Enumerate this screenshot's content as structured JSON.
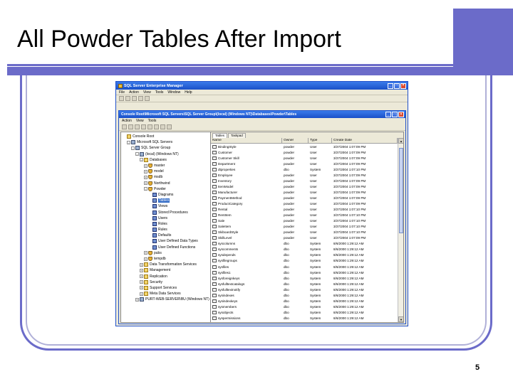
{
  "slide": {
    "title": "All Powder Tables After Import",
    "page_number": "5",
    "accent_color": "#6b6bc9"
  },
  "window": {
    "title": "SQL Server Enterprise Manager",
    "menu": [
      "File",
      "Action",
      "View",
      "Tools",
      "Window",
      "Help"
    ]
  },
  "inner_window": {
    "title": "Console Root\\Microsoft SQL Servers\\SQL Server Group\\(local) (Windows NT)\\Databases\\Powder\\Tables",
    "menu": [
      "Action",
      "View",
      "Tools"
    ]
  },
  "tree": [
    {
      "label": "Console Root",
      "level": 0,
      "icon": "folder",
      "exp": ""
    },
    {
      "label": "Microsoft SQL Servers",
      "level": 1,
      "icon": "srv",
      "exp": "-"
    },
    {
      "label": "SQL Server Group",
      "level": 2,
      "icon": "srv",
      "exp": "-"
    },
    {
      "label": "(local) (Windows NT)",
      "level": 3,
      "icon": "srv",
      "exp": "-"
    },
    {
      "label": "Databases",
      "level": 4,
      "icon": "folder",
      "exp": "-"
    },
    {
      "label": "master",
      "level": 5,
      "icon": "db",
      "exp": "+"
    },
    {
      "label": "model",
      "level": 5,
      "icon": "db",
      "exp": "+"
    },
    {
      "label": "msdb",
      "level": 5,
      "icon": "db",
      "exp": "+"
    },
    {
      "label": "Northwind",
      "level": 5,
      "icon": "db",
      "exp": "+"
    },
    {
      "label": "Powder",
      "level": 5,
      "icon": "db",
      "exp": "-"
    },
    {
      "label": "Diagrams",
      "level": 6,
      "icon": "obj",
      "exp": ""
    },
    {
      "label": "Tables",
      "level": 6,
      "icon": "obj",
      "exp": "",
      "selected": true
    },
    {
      "label": "Views",
      "level": 6,
      "icon": "obj",
      "exp": ""
    },
    {
      "label": "Stored Procedures",
      "level": 6,
      "icon": "obj",
      "exp": ""
    },
    {
      "label": "Users",
      "level": 6,
      "icon": "obj",
      "exp": ""
    },
    {
      "label": "Roles",
      "level": 6,
      "icon": "obj",
      "exp": ""
    },
    {
      "label": "Rules",
      "level": 6,
      "icon": "obj",
      "exp": ""
    },
    {
      "label": "Defaults",
      "level": 6,
      "icon": "obj",
      "exp": ""
    },
    {
      "label": "User Defined Data Types",
      "level": 6,
      "icon": "obj",
      "exp": ""
    },
    {
      "label": "User Defined Functions",
      "level": 6,
      "icon": "obj",
      "exp": ""
    },
    {
      "label": "pubs",
      "level": 5,
      "icon": "db",
      "exp": "+"
    },
    {
      "label": "tempdb",
      "level": 5,
      "icon": "db",
      "exp": "+"
    },
    {
      "label": "Data Transformation Services",
      "level": 4,
      "icon": "folder",
      "exp": "+"
    },
    {
      "label": "Management",
      "level": 4,
      "icon": "folder",
      "exp": "+"
    },
    {
      "label": "Replication",
      "level": 4,
      "icon": "folder",
      "exp": "+"
    },
    {
      "label": "Security",
      "level": 4,
      "icon": "folder",
      "exp": "+"
    },
    {
      "label": "Support Services",
      "level": 4,
      "icon": "folder",
      "exp": "+"
    },
    {
      "label": "Meta Data Services",
      "level": 4,
      "icon": "folder",
      "exp": "+"
    },
    {
      "label": "PURT-WEB-SERVER\\BU (Windows NT)",
      "level": 3,
      "icon": "srv",
      "exp": "+"
    }
  ],
  "tabs": [
    "Tables",
    "Taskpad"
  ],
  "columns": [
    "Name",
    "Owner",
    "Type",
    "Create Date"
  ],
  "rows": [
    [
      "BindingStyle",
      "powder",
      "User",
      "3/27/2004 1:07:09 PM"
    ],
    [
      "Customer",
      "powder",
      "User",
      "3/27/2004 1:07:09 PM"
    ],
    [
      "Customer Skill",
      "powder",
      "User",
      "3/27/2004 1:07:09 PM"
    ],
    [
      "Department",
      "powder",
      "User",
      "3/27/2004 1:07:09 PM"
    ],
    [
      "dtproperties",
      "dbo",
      "System",
      "3/27/2004 1:07:10 PM"
    ],
    [
      "Employee",
      "powder",
      "User",
      "3/27/2004 1:07:09 PM"
    ],
    [
      "Inventory",
      "powder",
      "User",
      "3/27/2004 1:07:09 PM"
    ],
    [
      "ItemModel",
      "powder",
      "User",
      "3/27/2004 1:07:09 PM"
    ],
    [
      "Manufacturer",
      "powder",
      "User",
      "3/27/2004 1:07:09 PM"
    ],
    [
      "PaymentMethod",
      "powder",
      "User",
      "3/27/2004 1:07:09 PM"
    ],
    [
      "ProductCategory",
      "powder",
      "User",
      "3/27/2004 1:07:09 PM"
    ],
    [
      "Rental",
      "powder",
      "User",
      "3/27/2004 1:07:10 PM"
    ],
    [
      "RentItem",
      "powder",
      "User",
      "3/27/2004 1:07:10 PM"
    ],
    [
      "Sale",
      "powder",
      "User",
      "3/27/2004 1:07:10 PM"
    ],
    [
      "SaleItem",
      "powder",
      "User",
      "3/27/2004 1:07:10 PM"
    ],
    [
      "SkiboardStyle",
      "powder",
      "User",
      "3/27/2004 1:07:10 PM"
    ],
    [
      "SkillLevel",
      "powder",
      "User",
      "3/27/2004 1:07:09 PM"
    ],
    [
      "syscolumns",
      "dbo",
      "System",
      "8/6/2000 1:29:12 AM"
    ],
    [
      "syscomments",
      "dbo",
      "System",
      "8/6/2000 1:29:12 AM"
    ],
    [
      "sysdepends",
      "dbo",
      "System",
      "8/6/2000 1:29:12 AM"
    ],
    [
      "sysfilegroups",
      "dbo",
      "System",
      "8/6/2000 1:29:12 AM"
    ],
    [
      "sysfiles",
      "dbo",
      "System",
      "8/6/2000 1:29:12 AM"
    ],
    [
      "sysfiles1",
      "dbo",
      "System",
      "8/6/2000 1:29:12 AM"
    ],
    [
      "sysforeignkeys",
      "dbo",
      "System",
      "8/6/2000 1:29:12 AM"
    ],
    [
      "sysfulltextcatalogs",
      "dbo",
      "System",
      "8/6/2000 1:29:12 AM"
    ],
    [
      "sysfulltextnotify",
      "dbo",
      "System",
      "8/6/2000 1:29:12 AM"
    ],
    [
      "sysindexes",
      "dbo",
      "System",
      "8/6/2000 1:29:12 AM"
    ],
    [
      "sysindexkeys",
      "dbo",
      "System",
      "8/6/2000 1:29:12 AM"
    ],
    [
      "sysmembers",
      "dbo",
      "System",
      "8/6/2000 1:29:12 AM"
    ],
    [
      "sysobjects",
      "dbo",
      "System",
      "8/6/2000 1:29:12 AM"
    ],
    [
      "syspermissions",
      "dbo",
      "System",
      "8/6/2000 1:29:12 AM"
    ],
    [
      "sysproperties",
      "dbo",
      "System",
      "8/6/2000 1:29:12 AM"
    ],
    [
      "sysprotects",
      "dbo",
      "System",
      "8/6/2000 1:29:12 AM"
    ]
  ]
}
